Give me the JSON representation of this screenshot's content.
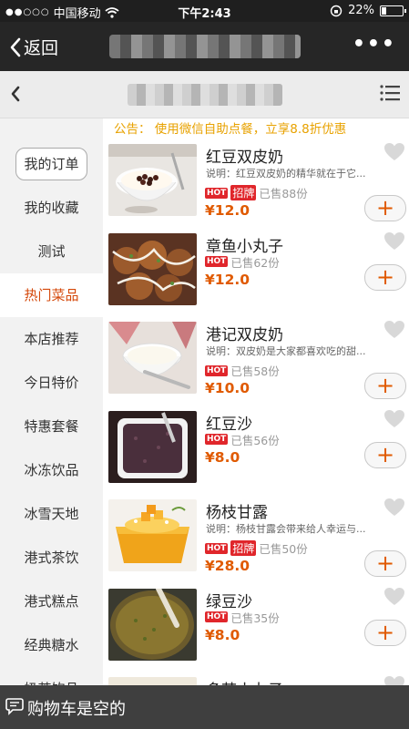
{
  "status_bar": {
    "carrier": "中国移动",
    "time": "下午2:43",
    "battery": "22%",
    "battery_level": 0.22
  },
  "nav": {
    "back_label": "返回"
  },
  "notice": "公告：  使用微信自助点餐，立享8.8折优惠",
  "sidebar": {
    "items": [
      {
        "label": "我的订单"
      },
      {
        "label": "我的收藏"
      },
      {
        "label": "测试"
      },
      {
        "label": "热门菜品"
      },
      {
        "label": "本店推荐"
      },
      {
        "label": "今日特价"
      },
      {
        "label": "特惠套餐"
      },
      {
        "label": "冰冻饮品"
      },
      {
        "label": "冰雪天地"
      },
      {
        "label": "港式茶饮"
      },
      {
        "label": "港式糕点"
      },
      {
        "label": "经典糖水"
      },
      {
        "label": "奶茶饮品"
      }
    ]
  },
  "badges": {
    "hot": "HOT",
    "zhaopai": "招牌"
  },
  "products": [
    {
      "name": "红豆双皮奶",
      "desc": "说明：红豆双皮奶的精华就在于它...",
      "sold": "已售88份",
      "price": "¥12.0",
      "zhaopai": true
    },
    {
      "name": "章鱼小丸子",
      "desc": "",
      "sold": "已售62份",
      "price": "¥12.0",
      "zhaopai": false
    },
    {
      "name": "港记双皮奶",
      "desc": "说明：双皮奶是大家都喜欢吃的甜...",
      "sold": "已售58份",
      "price": "¥10.0",
      "zhaopai": false
    },
    {
      "name": "红豆沙",
      "desc": "",
      "sold": "已售56份",
      "price": "¥8.0",
      "zhaopai": false
    },
    {
      "name": "杨枝甘露",
      "desc": "说明：杨枝甘露会带来给人幸运与...",
      "sold": "已售50份",
      "price": "¥28.0",
      "zhaopai": true
    },
    {
      "name": "绿豆沙",
      "desc": "",
      "sold": "已售35份",
      "price": "¥8.0",
      "zhaopai": false
    },
    {
      "name": "多芒小丸子",
      "desc": "",
      "sold": "",
      "price": "",
      "zhaopai": false
    }
  ],
  "add_label": "+",
  "cart": {
    "text": "购物车是空的"
  },
  "colors": {
    "accent": "#e05a00",
    "notice": "#e8a200",
    "hot": "#e0262b",
    "active_category": "#d4480a"
  }
}
